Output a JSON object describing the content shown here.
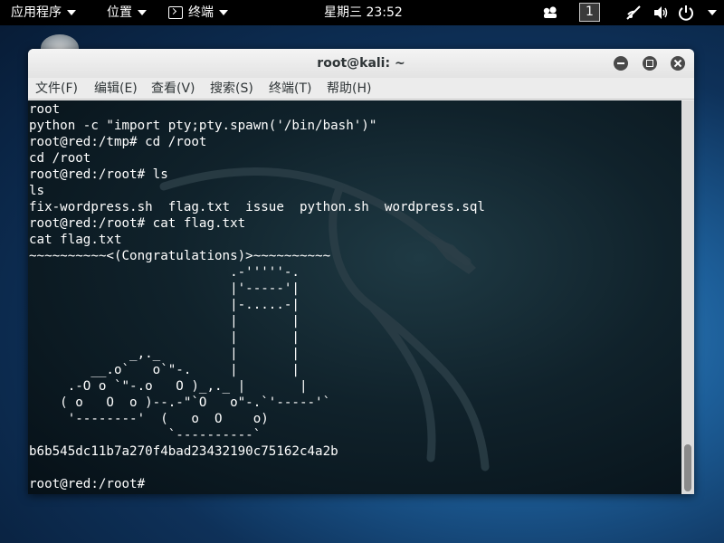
{
  "top_panel": {
    "applications_label": "应用程序",
    "places_label": "位置",
    "terminal_label": "终端",
    "clock": "星期三 23:52",
    "workspace": "1"
  },
  "window": {
    "title": "root@kali: ~",
    "menu": [
      "文件(F)",
      "编辑(E)",
      "查看(V)",
      "搜索(S)",
      "终端(T)",
      "帮助(H)"
    ]
  },
  "terminal": {
    "lines": [
      "root",
      "python -c \"import pty;pty.spawn('/bin/bash')\"",
      "root@red:/tmp# cd /root",
      "cd /root",
      "root@red:/root# ls",
      "ls",
      "fix-wordpress.sh  flag.txt  issue  python.sh  wordpress.sql",
      "root@red:/root# cat flag.txt",
      "cat flag.txt",
      "~~~~~~~~~~<(Congratulations)>~~~~~~~~~~",
      "                          .-'''''-.",
      "                          |'-----'|",
      "                          |-.....-|",
      "                          |       |",
      "                          |       |",
      "             _,._         |       |",
      "        __.o`   o`\"-.     |       |",
      "     .-O o `\"-.o   O )_,._ |       |",
      "    ( o   O  o )--.-\"`O   o\"-.`'-----'`",
      "     '--------'  (   o  O    o)",
      "                  `----------`",
      "b6b545dc11b7a270f4bad23432190c75162c4a2b",
      "",
      "root@red:/root# "
    ]
  },
  "colors": {
    "panel_bg": "#000000",
    "terminal_text": "#ffffff",
    "titlebar_bg": "#ececec"
  },
  "icons": [
    "chevron-down-icon",
    "terminal-app-icon",
    "mixer-icon",
    "no-network-icon",
    "volume-icon",
    "power-icon",
    "minimize-icon",
    "maximize-icon",
    "close-icon",
    "kali-dragon-icon"
  ]
}
